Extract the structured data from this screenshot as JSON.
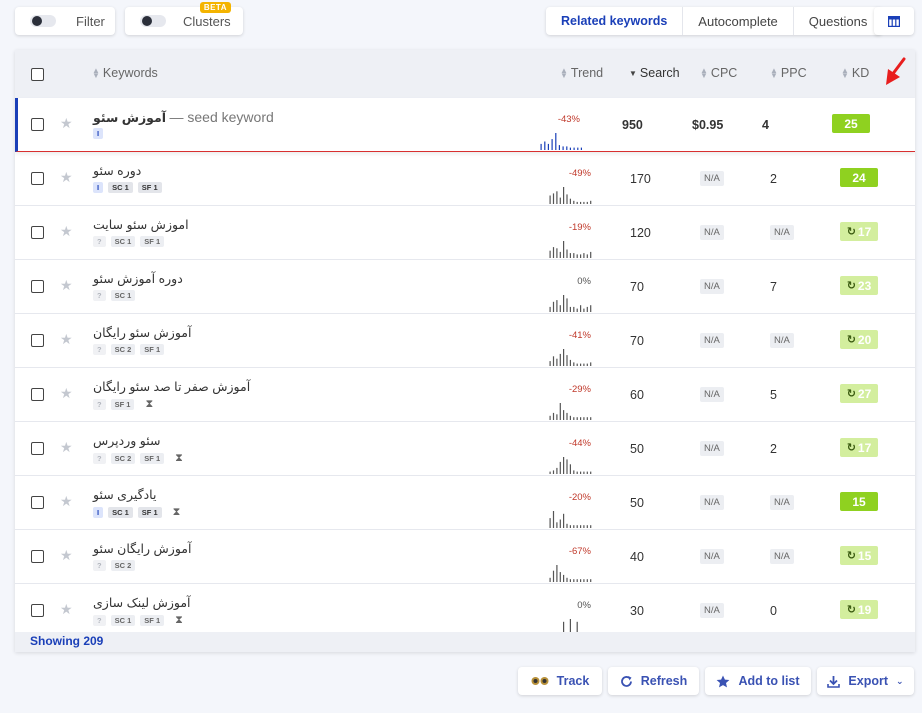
{
  "toolbar": {
    "filter_label": "Filter",
    "clusters_label": "Clusters",
    "beta_label": "BETA",
    "tabs": [
      "Related keywords",
      "Autocomplete",
      "Questions"
    ],
    "active_tab": "Related keywords"
  },
  "table": {
    "headers": {
      "keywords": "Keywords",
      "trend": "Trend",
      "search": "Search",
      "cpc": "CPC",
      "ppc": "PPC",
      "kd": "KD"
    },
    "seed": {
      "keyword": "آموزش سئو",
      "suffix": "— seed keyword",
      "intent": "I",
      "trend_pct": "-43%",
      "trend": [
        5,
        7,
        5,
        9,
        14,
        4,
        3,
        3,
        2,
        2,
        2,
        2
      ],
      "search": "950",
      "cpc": "$0.95",
      "ppc": "4",
      "kd": "25"
    },
    "rows": [
      {
        "keyword": "دوره سئو",
        "intent": "I",
        "sc": "SC 1",
        "sf": "SF 1",
        "hourglass": false,
        "trend_pct": "-49%",
        "trend": [
          8,
          10,
          12,
          6,
          16,
          9,
          5,
          3,
          2,
          2,
          2,
          2,
          3
        ],
        "search": "170",
        "cpc": "N/A",
        "ppc": "2",
        "kd": "24",
        "kd_refresh": false
      },
      {
        "keyword": "اموزش سئو سایت",
        "intent": "?",
        "sc": "SC 1",
        "sf": "SF 1",
        "hourglass": false,
        "trend_pct": "-19%",
        "trend": [
          6,
          9,
          8,
          5,
          14,
          7,
          4,
          4,
          3,
          3,
          4,
          3,
          5
        ],
        "search": "120",
        "cpc": "N/A",
        "ppc": "N/A",
        "kd": "17",
        "kd_refresh": true
      },
      {
        "keyword": "دوره آموزش سئو",
        "intent": "?",
        "sc": "SC 1",
        "sf": "",
        "hourglass": false,
        "trend_pct": "0%",
        "trend": [
          3,
          6,
          7,
          4,
          10,
          8,
          3,
          3,
          2,
          4,
          2,
          3,
          4
        ],
        "search": "70",
        "cpc": "N/A",
        "ppc": "7",
        "kd": "23",
        "kd_refresh": true
      },
      {
        "keyword": "آموزش سئو رایگان",
        "intent": "?",
        "sc": "SC 2",
        "sf": "SF 1",
        "hourglass": false,
        "trend_pct": "-41%",
        "trend": [
          4,
          8,
          6,
          10,
          14,
          9,
          5,
          3,
          2,
          2,
          2,
          2,
          3
        ],
        "search": "70",
        "cpc": "N/A",
        "ppc": "N/A",
        "kd": "20",
        "kd_refresh": true
      },
      {
        "keyword": "آموزش صفر تا صد سئو رایگان",
        "intent": "?",
        "sc": "",
        "sf": "SF 1",
        "hourglass": true,
        "trend_pct": "-29%",
        "trend": [
          3,
          5,
          4,
          12,
          7,
          5,
          3,
          2,
          2,
          2,
          2,
          2,
          2
        ],
        "search": "60",
        "cpc": "N/A",
        "ppc": "5",
        "kd": "27",
        "kd_refresh": true
      },
      {
        "keyword": "سئو وردپرس",
        "intent": "?",
        "sc": "SC 2",
        "sf": "SF 1",
        "hourglass": true,
        "trend_pct": "-44%",
        "trend": [
          2,
          3,
          5,
          10,
          14,
          12,
          8,
          3,
          2,
          2,
          2,
          2,
          2
        ],
        "search": "50",
        "cpc": "N/A",
        "ppc": "2",
        "kd": "17",
        "kd_refresh": true
      },
      {
        "keyword": "یادگیری سئو",
        "intent": "I",
        "sc": "SC 1",
        "sf": "SF 1",
        "hourglass": true,
        "trend_pct": "-20%",
        "trend": [
          7,
          12,
          4,
          6,
          10,
          3,
          2,
          2,
          2,
          2,
          2,
          2,
          2
        ],
        "search": "50",
        "cpc": "N/A",
        "ppc": "N/A",
        "kd": "15",
        "kd_refresh": false
      },
      {
        "keyword": "آموزش رایگان سئو",
        "intent": "?",
        "sc": "SC 2",
        "sf": "",
        "hourglass": false,
        "trend_pct": "-67%",
        "trend": [
          3,
          8,
          12,
          7,
          5,
          3,
          2,
          2,
          2,
          2,
          2,
          2,
          2
        ],
        "search": "40",
        "cpc": "N/A",
        "ppc": "N/A",
        "kd": "15",
        "kd_refresh": true
      },
      {
        "keyword": "آموزش لینک سازی",
        "intent": "?",
        "sc": "SC 1",
        "sf": "SF 1",
        "hourglass": true,
        "trend_pct": "0%",
        "trend": [
          0,
          0,
          0,
          0,
          10,
          0,
          12,
          0,
          10,
          0,
          0,
          0,
          0
        ],
        "search": "30",
        "cpc": "N/A",
        "ppc": "0",
        "kd": "19",
        "kd_refresh": true
      }
    ],
    "showing": "Showing 209"
  },
  "actions": {
    "track": "Track",
    "refresh": "Refresh",
    "add_to_list": "Add to list",
    "export": "Export"
  },
  "colors": {
    "accent": "#1a3fb8",
    "kd_green": "#8fd120",
    "kd_light": "#d3ee9e",
    "trend_bar": "#1a3fb8",
    "trend_red": "#c0392b",
    "annotation_arrow": "#e81e1e"
  }
}
